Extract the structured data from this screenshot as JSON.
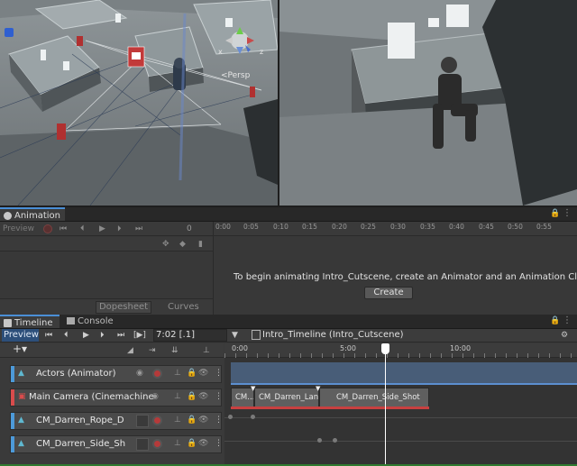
{
  "scene": {
    "persp_label": "<Persp",
    "axis_x": "x",
    "axis_z": "z"
  },
  "animation": {
    "tab_label": "Animation",
    "preview_label": "Preview",
    "frame_value": "0",
    "ruler_ticks": [
      "0:00",
      "0:05",
      "0:10",
      "0:15",
      "0:20",
      "0:25",
      "0:30",
      "0:35",
      "0:40",
      "0:45",
      "0:50",
      "0:55"
    ],
    "message": "To begin animating Intro_Cutscene, create an Animator and an Animation Clip.",
    "create_button": "Create",
    "dopesheet_label": "Dopesheet",
    "curves_label": "Curves"
  },
  "timeline": {
    "tab_label": "Timeline",
    "console_tab_label": "Console",
    "preview_label": "Preview",
    "time_value": "7:02 [.1]",
    "asset_label": "Intro_Timeline (Intro_Cutscene)",
    "ruler_ticks": [
      "0:00",
      "5:00",
      "10:00"
    ],
    "tracks": [
      {
        "label": "Actors (Animator)",
        "color": "#4d9ad9"
      },
      {
        "label": "Main Camera (Cinemachine",
        "color": "#d94c4c"
      },
      {
        "label": "CM_Darren_Rope_D",
        "color": "#4d9ad9"
      },
      {
        "label": "CM_Darren_Side_Sh",
        "color": "#4d9ad9"
      }
    ],
    "clips": [
      "CM...",
      "CM_Darren_Lan...",
      "CM_Darren_Side_Shot"
    ]
  },
  "colors": {
    "accent_blue": "#4d9ad9",
    "record_red": "#d94c4c",
    "playhead": "#ffffff",
    "create_button": "#585858"
  }
}
